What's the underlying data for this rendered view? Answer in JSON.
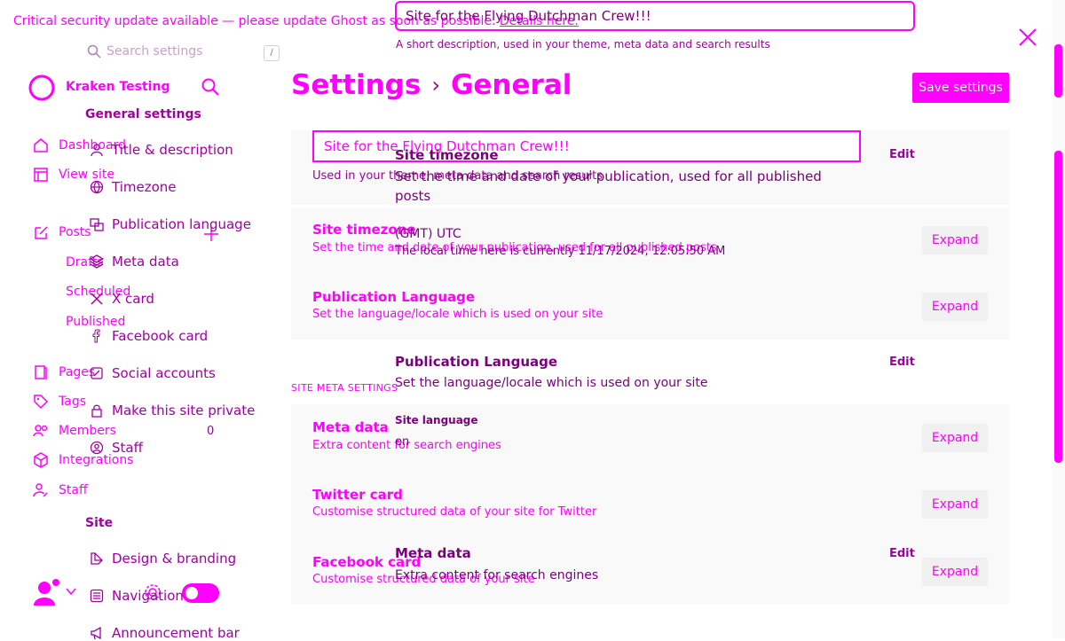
{
  "banner": {
    "text": "Critical security update available — please update Ghost as soon as possible.",
    "link": "Details here."
  },
  "search": {
    "placeholder": "Search settings",
    "shortcut": "/"
  },
  "brand": {
    "name": "Kraken Testing"
  },
  "sidebar": {
    "dashboard": "Dashboard",
    "view_site": "View site",
    "posts": "Posts",
    "drafts": "Drafts",
    "scheduled": "Scheduled",
    "published": "Published",
    "pages": "Pages",
    "tags": "Tags",
    "members": "Members",
    "members_count": "0",
    "integrations": "Integrations",
    "staff": "Staff"
  },
  "settings_nav": {
    "general_heading": "General settings",
    "items": [
      "Title & description",
      "Timezone",
      "Publication language",
      "Meta data",
      "X card",
      "Facebook card",
      "Social accounts",
      "Make this site private",
      "Staff"
    ],
    "site_heading": "Site",
    "site_items": [
      "Design & branding",
      "Navigation",
      "Announcement bar"
    ]
  },
  "header": {
    "settings": "Settings",
    "general": "General",
    "save": "Save settings"
  },
  "top_input": {
    "value": "Site for the Flying Dutchman Crew!!!",
    "hint": "A short description, used in your theme, meta data and search results"
  },
  "mid_input": {
    "value": "Site for the Flying Dutchman Crew!!!",
    "hint": "Used in your theme, meta data and search results"
  },
  "overlay": {
    "site_timezone_title": "Site timezone",
    "site_timezone_desc_1": "Set the time and date of your publication, used for all published",
    "site_timezone_desc_2": "posts",
    "tz_value": "(GMT) UTC",
    "tz_local": "The local time here is currently 11/17/2024, 12:05:50 AM",
    "edit": "Edit",
    "pub_lang_title": "Publication Language",
    "pub_lang_desc": "Set the language/locale which is used on your site",
    "site_language_label": "Site language",
    "site_language_value": "en",
    "meta_title": "Meta data",
    "meta_desc": "Extra content for search engines"
  },
  "rows": {
    "timezone": {
      "title": "Site timezone",
      "desc": "Set the time and date of your publication, used for all published posts",
      "button": "Expand"
    },
    "language": {
      "title": "Publication Language",
      "desc": "Set the language/locale which is used on your site",
      "button": "Expand"
    },
    "section_label": "SITE META SETTINGS",
    "meta": {
      "title": "Meta data",
      "desc": "Extra content for search engines",
      "button": "Expand"
    },
    "twitter": {
      "title": "Twitter card",
      "desc": "Customise structured data of your site for Twitter",
      "button": "Expand"
    },
    "facebook": {
      "title": "Facebook card",
      "desc": "Customise structured data of your site",
      "button": "Expand"
    }
  },
  "colors": {
    "accent": "#ff00ff",
    "dark_accent": "#a000a0",
    "card_bg": "#f9f9f9"
  },
  "icons": [
    "search-icon",
    "close-icon",
    "logo-icon",
    "home-icon",
    "view-site-icon",
    "posts-icon",
    "pages-icon",
    "tags-icon",
    "members-icon",
    "integrations-icon",
    "staff-icon",
    "globe-icon",
    "language-icon",
    "meta-icon",
    "x-icon",
    "facebook-icon",
    "social-icon",
    "lock-icon",
    "user-icon",
    "brush-icon",
    "navigation-icon",
    "announcement-icon",
    "avatar-icon",
    "gear-icon",
    "plus-icon"
  ]
}
